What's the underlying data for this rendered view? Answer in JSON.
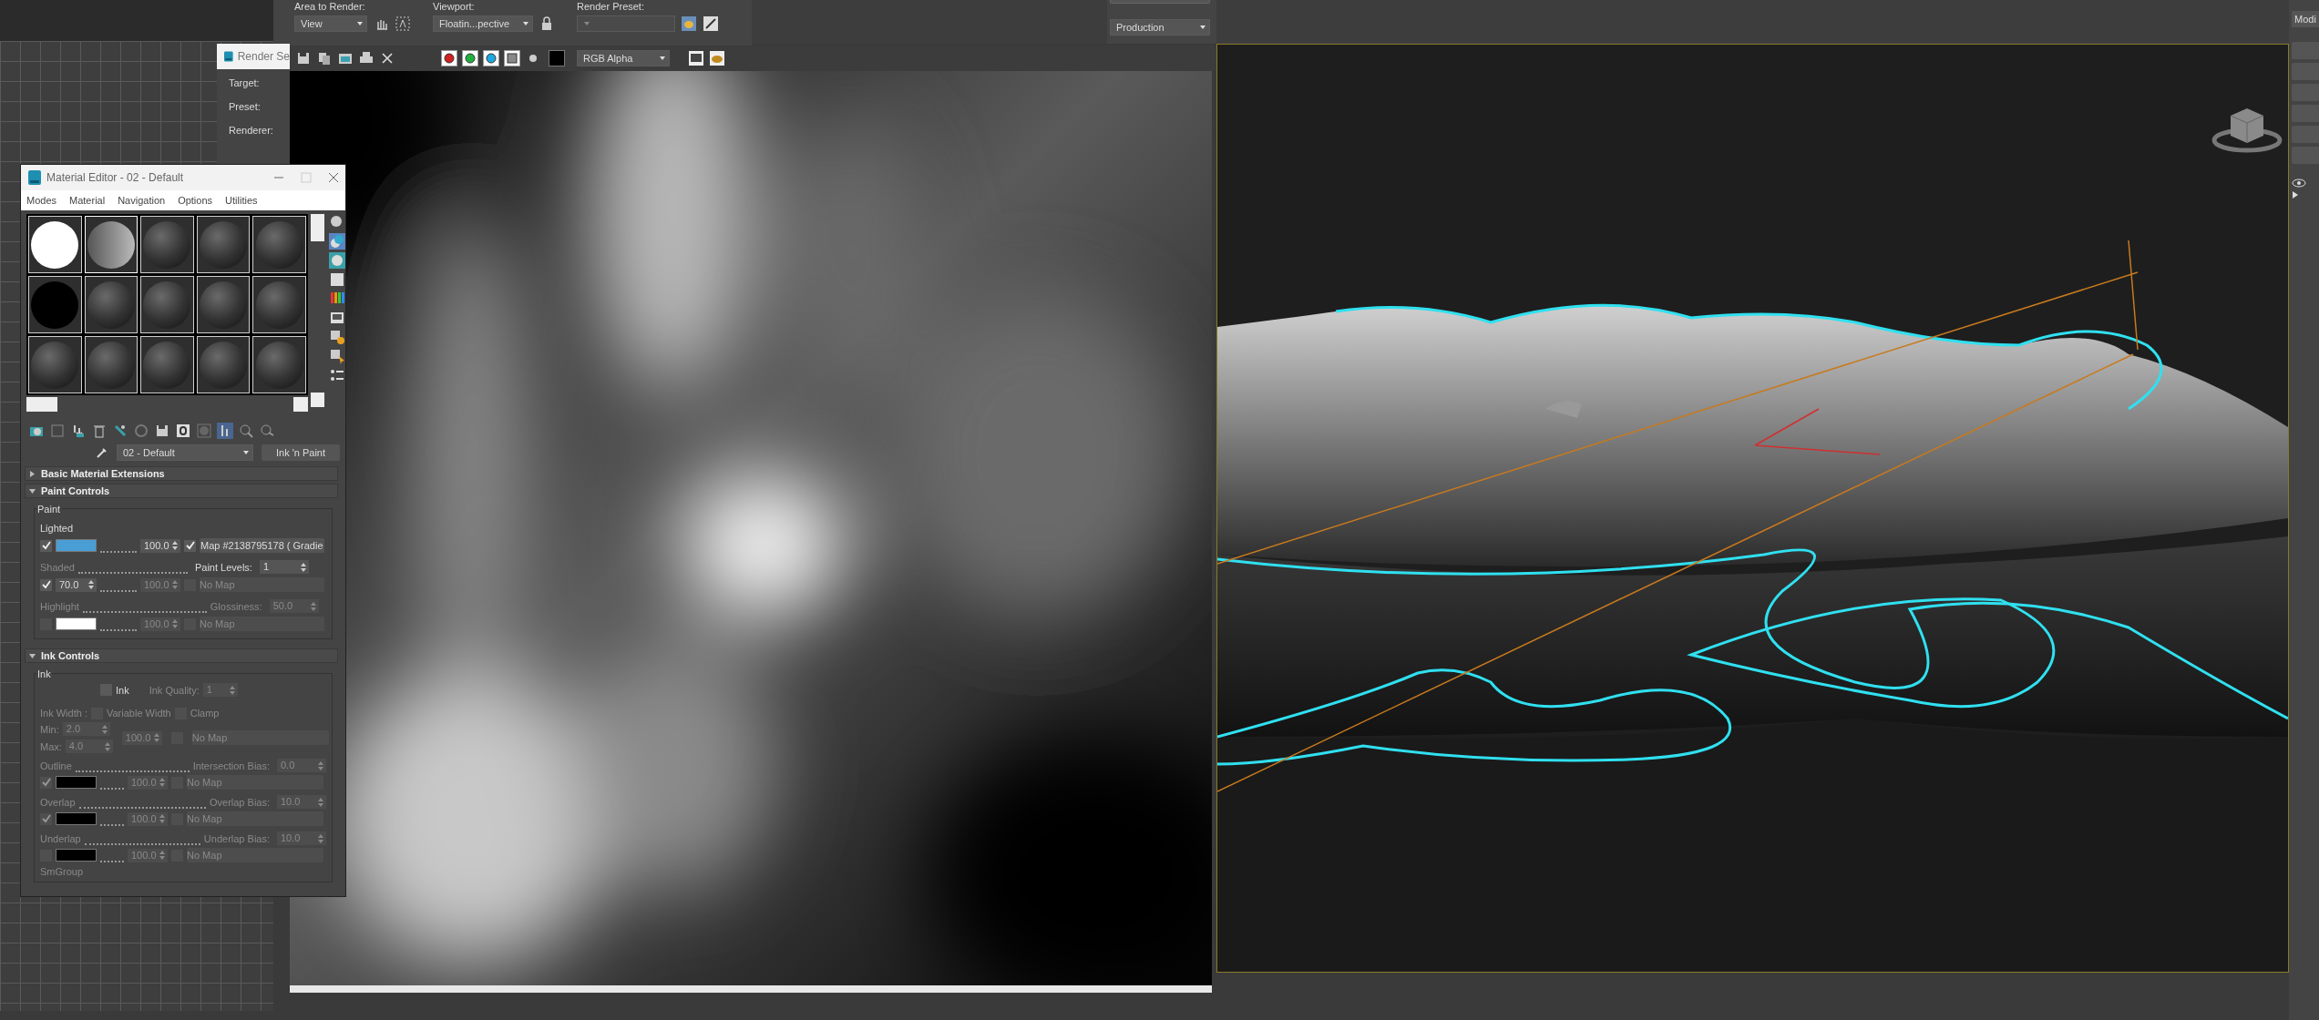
{
  "render_frame": {
    "area_to_render": {
      "label": "Area to Render:",
      "value": "View"
    },
    "viewport": {
      "label": "Viewport:",
      "value": "Floatin...pective"
    },
    "render_preset": {
      "label": "Render Preset:",
      "disabled": true
    },
    "preset_mode": "Production",
    "channel_buttons": [
      {
        "kind": "red",
        "on": true
      },
      {
        "kind": "green",
        "on": true
      },
      {
        "kind": "blue",
        "on": true
      },
      {
        "kind": "alpha",
        "on": true
      },
      {
        "kind": "mono",
        "on": false
      }
    ],
    "channel_display": "RGB Alpha"
  },
  "render_setup": {
    "title": "Render Se",
    "fields": [
      "Target:",
      "Preset:",
      "Renderer:"
    ]
  },
  "command_panel": {
    "tab": "Modi"
  },
  "material_editor": {
    "title": "Material Editor - 02 - Default",
    "menu": [
      "Modes",
      "Material",
      "Navigation",
      "Options",
      "Utilities"
    ],
    "slots": [
      {
        "kind": "white",
        "selected": false
      },
      {
        "kind": "gradient",
        "selected": true
      },
      {
        "kind": "standard",
        "selected": false
      },
      {
        "kind": "standard",
        "selected": false
      },
      {
        "kind": "standard",
        "selected": false
      },
      {
        "kind": "black",
        "selected": false
      },
      {
        "kind": "standard",
        "selected": false
      },
      {
        "kind": "standard",
        "selected": false
      },
      {
        "kind": "standard",
        "selected": false
      },
      {
        "kind": "standard",
        "selected": false
      },
      {
        "kind": "standard",
        "selected": false
      },
      {
        "kind": "standard",
        "selected": false
      },
      {
        "kind": "standard",
        "selected": false
      },
      {
        "kind": "standard",
        "selected": false
      },
      {
        "kind": "standard",
        "selected": false
      }
    ],
    "material_name": "02 - Default",
    "type_button": "Ink 'n Paint",
    "basic_extensions": {
      "title": "Basic Material Extensions",
      "expanded": false
    },
    "paint_controls": {
      "title": "Paint Controls",
      "expanded": true,
      "group": "Paint",
      "lighted": {
        "label": "Lighted",
        "checked": true,
        "color": "#4a9ed6",
        "amount": "100.0",
        "map_checked": true,
        "map": "Map #2138795178 ( Gradie"
      },
      "shaded": {
        "label": "Shaded",
        "disabled": true,
        "checked": true,
        "value": "70.0",
        "amount": "100.0",
        "map_checked": false,
        "map": "No Map"
      },
      "paint_levels": {
        "label": "Paint Levels:",
        "value": "1"
      },
      "highlight": {
        "label": "Highlight",
        "disabled": true,
        "checked": false,
        "color": "#ffffff",
        "amount": "100.0",
        "map_checked": false,
        "map": "No Map"
      },
      "glossiness": {
        "label": "Glossiness:",
        "value": "50.0"
      }
    },
    "ink_controls": {
      "title": "Ink Controls",
      "expanded": true,
      "group": "Ink",
      "enabled": false,
      "ink": {
        "label": "Ink",
        "checked": false
      },
      "quality": {
        "label": "Ink Quality:",
        "value": "1"
      },
      "width_label": "Ink Width :",
      "variable_width": {
        "label": "Variable Width",
        "checked": false
      },
      "clamp": {
        "label": "Clamp",
        "checked": false
      },
      "min": {
        "label": "Min:",
        "value": "2.0"
      },
      "max": {
        "label": "Max:",
        "value": "4.0"
      },
      "width_amount": "100.0",
      "width_map": "No Map",
      "layers": [
        {
          "label": "Outline",
          "bias_label": "Intersection Bias:",
          "bias": "0.0",
          "checked": true,
          "color": "#000000",
          "amount": "100.0",
          "map": "No Map"
        },
        {
          "label": "Overlap",
          "bias_label": "Overlap Bias:",
          "bias": "10.0",
          "checked": true,
          "color": "#000000",
          "amount": "100.0",
          "map": "No Map"
        },
        {
          "label": "Underlap",
          "bias_label": "Underlap Bias:",
          "bias": "10.0",
          "checked": false,
          "color": "#000000",
          "amount": "100.0",
          "map": "No Map"
        }
      ],
      "smgroup": "SmGroup"
    }
  }
}
